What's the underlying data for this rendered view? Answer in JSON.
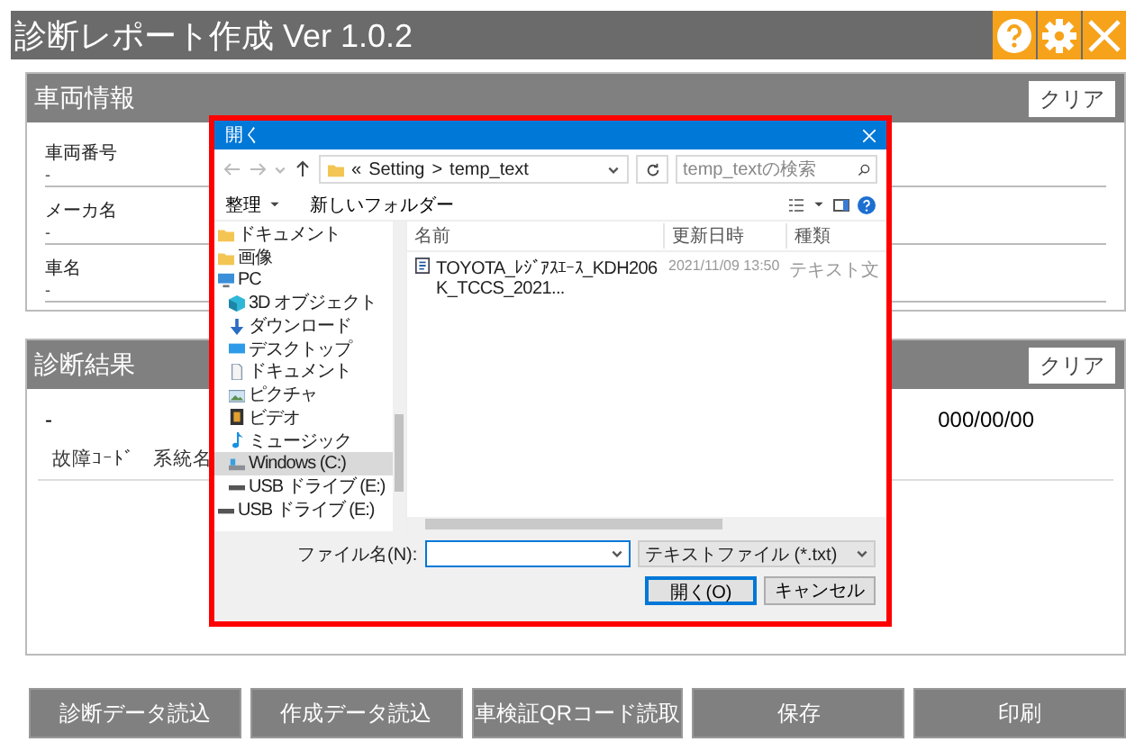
{
  "app": {
    "title": "診断レポート作成 Ver 1.0.2"
  },
  "vehicle_panel": {
    "title": "車両情報",
    "clear_button": "クリア",
    "fields": [
      {
        "label": "車両番号",
        "value": "-"
      },
      {
        "label": "メーカ名",
        "value": "-"
      },
      {
        "label": "車名",
        "value": "-"
      }
    ]
  },
  "diagnosis_panel": {
    "title": "診断結果",
    "clear_button": "クリア",
    "summary": "-",
    "date": "000/00/00",
    "columns": [
      "故障ｺｰﾄﾞ",
      "系統名"
    ]
  },
  "actions": [
    "診断データ読込",
    "作成データ読込",
    "車検証QRコード読取",
    "保存",
    "印刷"
  ],
  "open_dialog": {
    "title": "開く",
    "address": {
      "prefix": "«",
      "separator": ">",
      "segments": [
        "Setting",
        "temp_text"
      ]
    },
    "search": {
      "placeholder": "temp_textの検索"
    },
    "toolbar": {
      "organize": "整理",
      "new_folder": "新しいフォルダー"
    },
    "nav_tree": [
      {
        "label": "ドキュメント",
        "kind": "folder",
        "selected": false
      },
      {
        "label": "画像",
        "kind": "folder",
        "selected": false
      },
      {
        "label": "PC",
        "kind": "pc",
        "selected": false,
        "children": [
          {
            "label": "3D オブジェクト",
            "kind": "cube",
            "selected": false
          },
          {
            "label": "ダウンロード",
            "kind": "download",
            "selected": false
          },
          {
            "label": "デスクトップ",
            "kind": "desktop",
            "selected": false
          },
          {
            "label": "ドキュメント",
            "kind": "document",
            "selected": false
          },
          {
            "label": "ピクチャ",
            "kind": "picture",
            "selected": false
          },
          {
            "label": "ビデオ",
            "kind": "video",
            "selected": false
          },
          {
            "label": "ミュージック",
            "kind": "music",
            "selected": false
          },
          {
            "label": "Windows (C:)",
            "kind": "disk",
            "selected": true
          },
          {
            "label": "USB ドライブ (E:)",
            "kind": "usb",
            "selected": false
          }
        ]
      },
      {
        "label": "USB ドライブ (E:)",
        "kind": "usb",
        "selected": false
      }
    ],
    "columns": [
      "名前",
      "更新日時",
      "種類"
    ],
    "files": [
      {
        "name": "TOYOTA_ﾚｼﾞｱｽｴｰｽ_KDH206K_TCCS_2021...",
        "modified": "2021/11/09 13:50",
        "type": "テキスト文"
      }
    ],
    "file_name_label": "ファイル名(N):",
    "filter": "テキストファイル (*.txt)",
    "buttons": [
      {
        "label": "開く(O)",
        "kind": "primary"
      },
      {
        "label": "キャンセル",
        "kind": "secondary"
      }
    ]
  }
}
